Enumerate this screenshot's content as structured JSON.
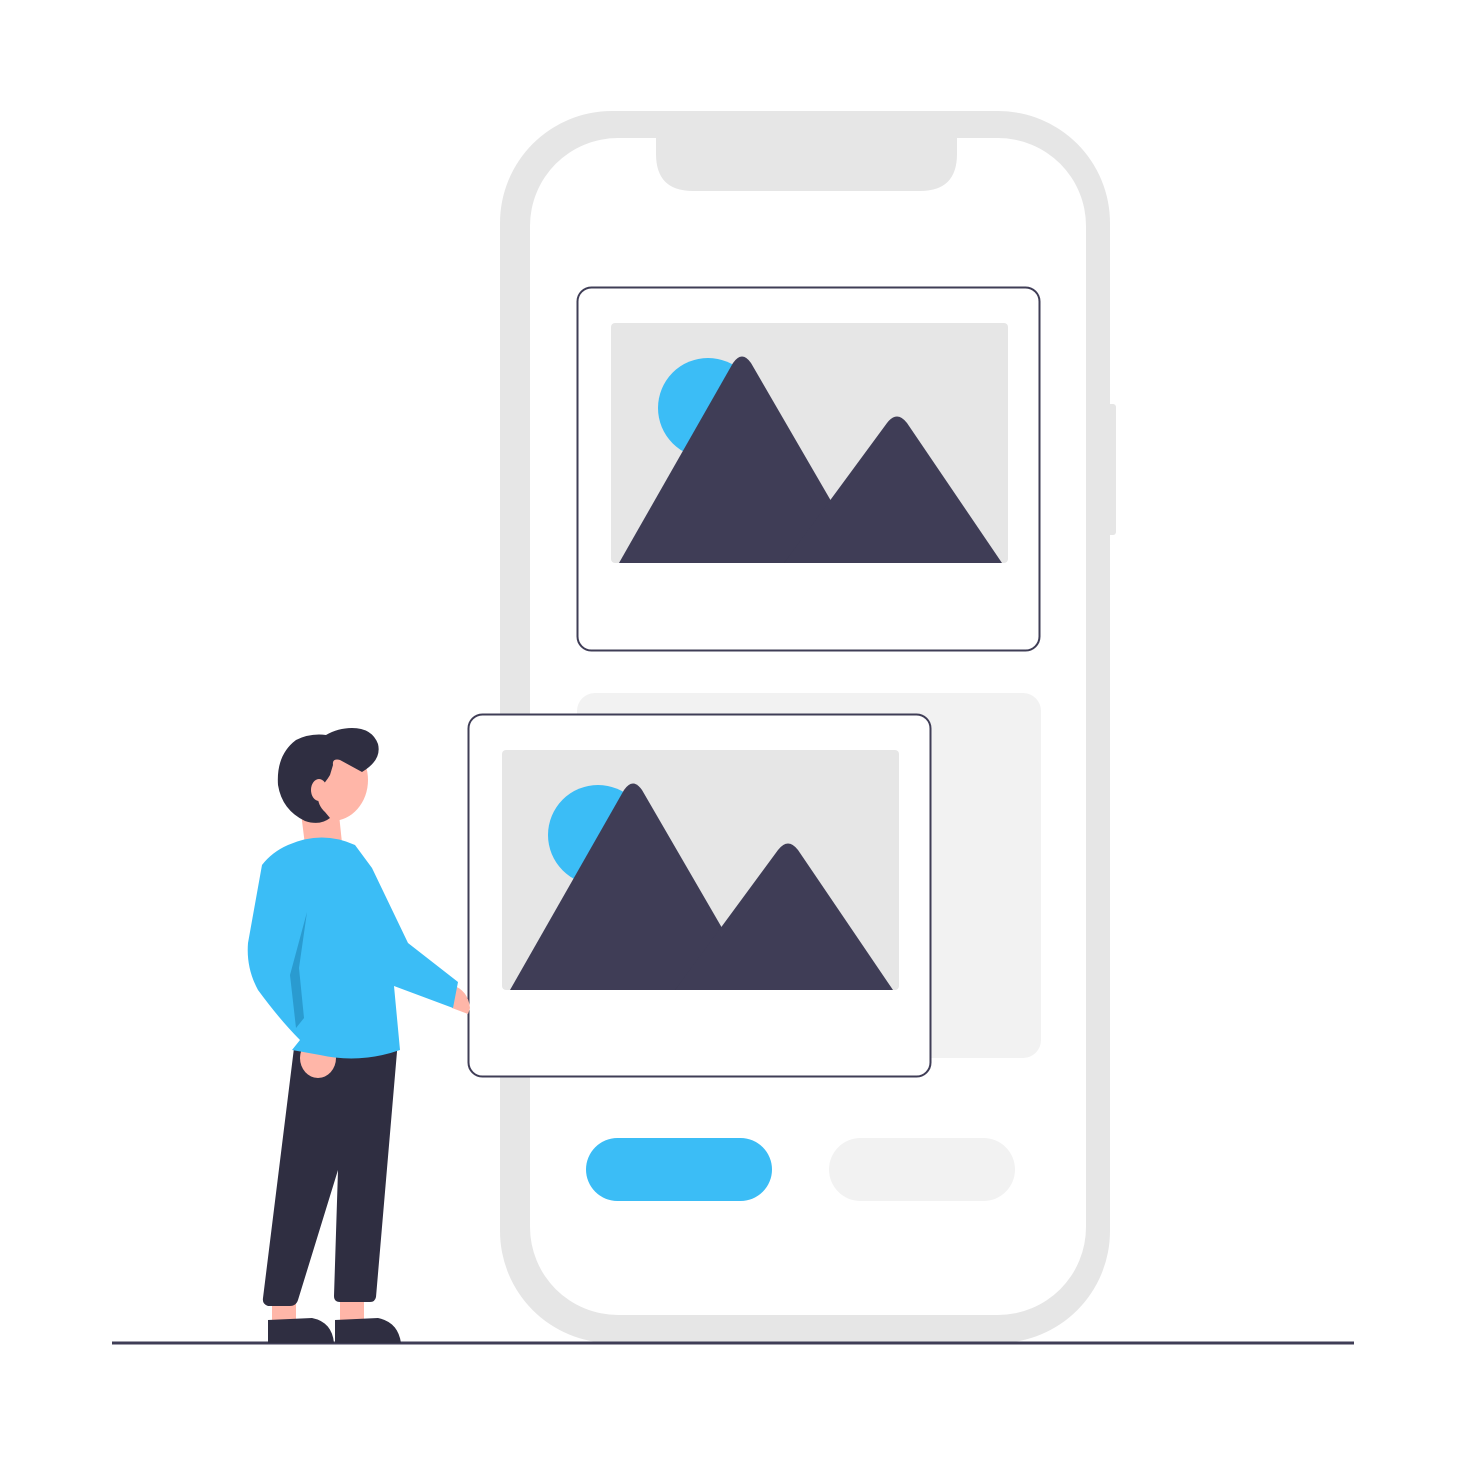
{
  "illustration": {
    "subject": "person-viewing-photo-gallery-on-phone",
    "colors": {
      "background": "#ffffff",
      "phone_frame": "#e6e6e6",
      "phone_screen": "#ffffff",
      "placeholder_card": "#f2f2f2",
      "image_area": "#e6e6e6",
      "mountain": "#3f3d56",
      "mountain_shadow": "#2f2e41",
      "sun": "#3bbdf6",
      "card_border": "#3f3d56",
      "primary_button": "#3bbdf6",
      "secondary_button": "#f2f2f2",
      "ground_line": "#3f3d56",
      "shirt": "#3bbdf6",
      "shirt_fold": "#2a9bd0",
      "pants": "#2f2e41",
      "shoes": "#2f2e41",
      "hair": "#2f2e41",
      "skin": "#ffb6a8"
    },
    "icons": [
      "mountain-image-icon",
      "sun-icon"
    ]
  }
}
